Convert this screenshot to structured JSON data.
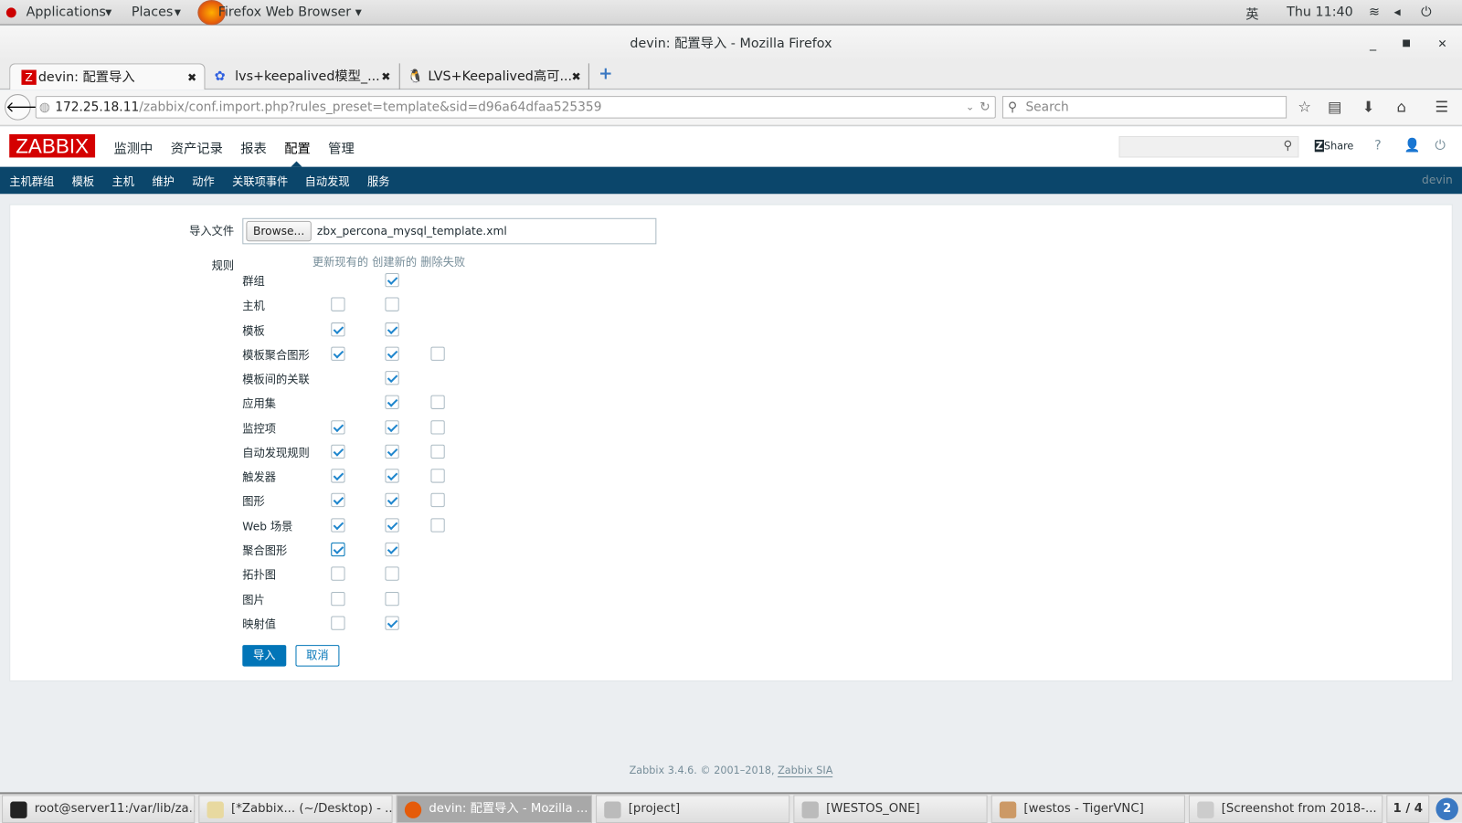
{
  "system_bar": {
    "applications": "Applications",
    "places": "Places",
    "active_app": "Firefox Web Browser",
    "input_method": "英",
    "clock": "Thu 11:40"
  },
  "window": {
    "title": "devin: 配置导入 - Mozilla Firefox"
  },
  "tabs": [
    {
      "label": "devin: 配置导入",
      "active": true
    },
    {
      "label": "lvs+keepalived模型_...",
      "active": false
    },
    {
      "label": "LVS+Keepalived高可...",
      "active": false
    }
  ],
  "address": {
    "host": "172.25.18.11",
    "path": "/zabbix/conf.import.php?rules_preset=template&sid=d96a64dfaa525359",
    "search_placeholder": "Search"
  },
  "zabbix": {
    "logo": "ZABBIX",
    "main_menu": [
      "监测中",
      "资产记录",
      "报表",
      "配置",
      "管理"
    ],
    "active_menu": "配置",
    "share": "Share",
    "help": "?",
    "sub_menu": [
      "主机群组",
      "模板",
      "主机",
      "维护",
      "动作",
      "关联项事件",
      "自动发现",
      "服务"
    ],
    "user": "devin"
  },
  "form": {
    "file_label": "导入文件",
    "browse": "Browse...",
    "file_name": "zbx_percona_mysql_template.xml",
    "rules_label": "规则",
    "columns": [
      "更新现有的",
      "创建新的",
      "删除失败"
    ],
    "rules": [
      {
        "label": "群组",
        "update": null,
        "create": true,
        "delete": null
      },
      {
        "label": "主机",
        "update": false,
        "create": false,
        "delete": null
      },
      {
        "label": "模板",
        "update": true,
        "create": true,
        "delete": null
      },
      {
        "label": "模板聚合图形",
        "update": true,
        "create": true,
        "delete": false
      },
      {
        "label": "模板间的关联",
        "update": null,
        "create": true,
        "delete": null
      },
      {
        "label": "应用集",
        "update": null,
        "create": true,
        "delete": false
      },
      {
        "label": "监控项",
        "update": true,
        "create": true,
        "delete": false
      },
      {
        "label": "自动发现规则",
        "update": true,
        "create": true,
        "delete": false
      },
      {
        "label": "触发器",
        "update": true,
        "create": true,
        "delete": false
      },
      {
        "label": "图形",
        "update": true,
        "create": true,
        "delete": false
      },
      {
        "label": "Web 场景",
        "update": true,
        "create": true,
        "delete": false
      },
      {
        "label": "聚合图形",
        "update": true,
        "create": true,
        "delete": null
      },
      {
        "label": "拓扑图",
        "update": false,
        "create": false,
        "delete": null
      },
      {
        "label": "图片",
        "update": false,
        "create": false,
        "delete": null
      },
      {
        "label": "映射值",
        "update": false,
        "create": true,
        "delete": null
      }
    ],
    "import_button": "导入",
    "cancel_button": "取消"
  },
  "footer": {
    "text": "Zabbix 3.4.6. © 2001–2018, ",
    "link": "Zabbix SIA"
  },
  "taskbar": {
    "items": [
      "root@server11:/var/lib/za...",
      "[*Zabbix... (~/Desktop) - ...",
      "devin: 配置导入 - Mozilla ...",
      "[project]",
      "[WESTOS_ONE]",
      "[westos - TigerVNC]",
      "[Screenshot from 2018-..."
    ],
    "workspace": "1 / 4",
    "badge": "2"
  },
  "colors": {
    "zabbix_red": "#d40000",
    "submenu_bg": "#0b466b",
    "primary_button": "#0275b8",
    "checkbox_tick": "#1f86cd"
  }
}
